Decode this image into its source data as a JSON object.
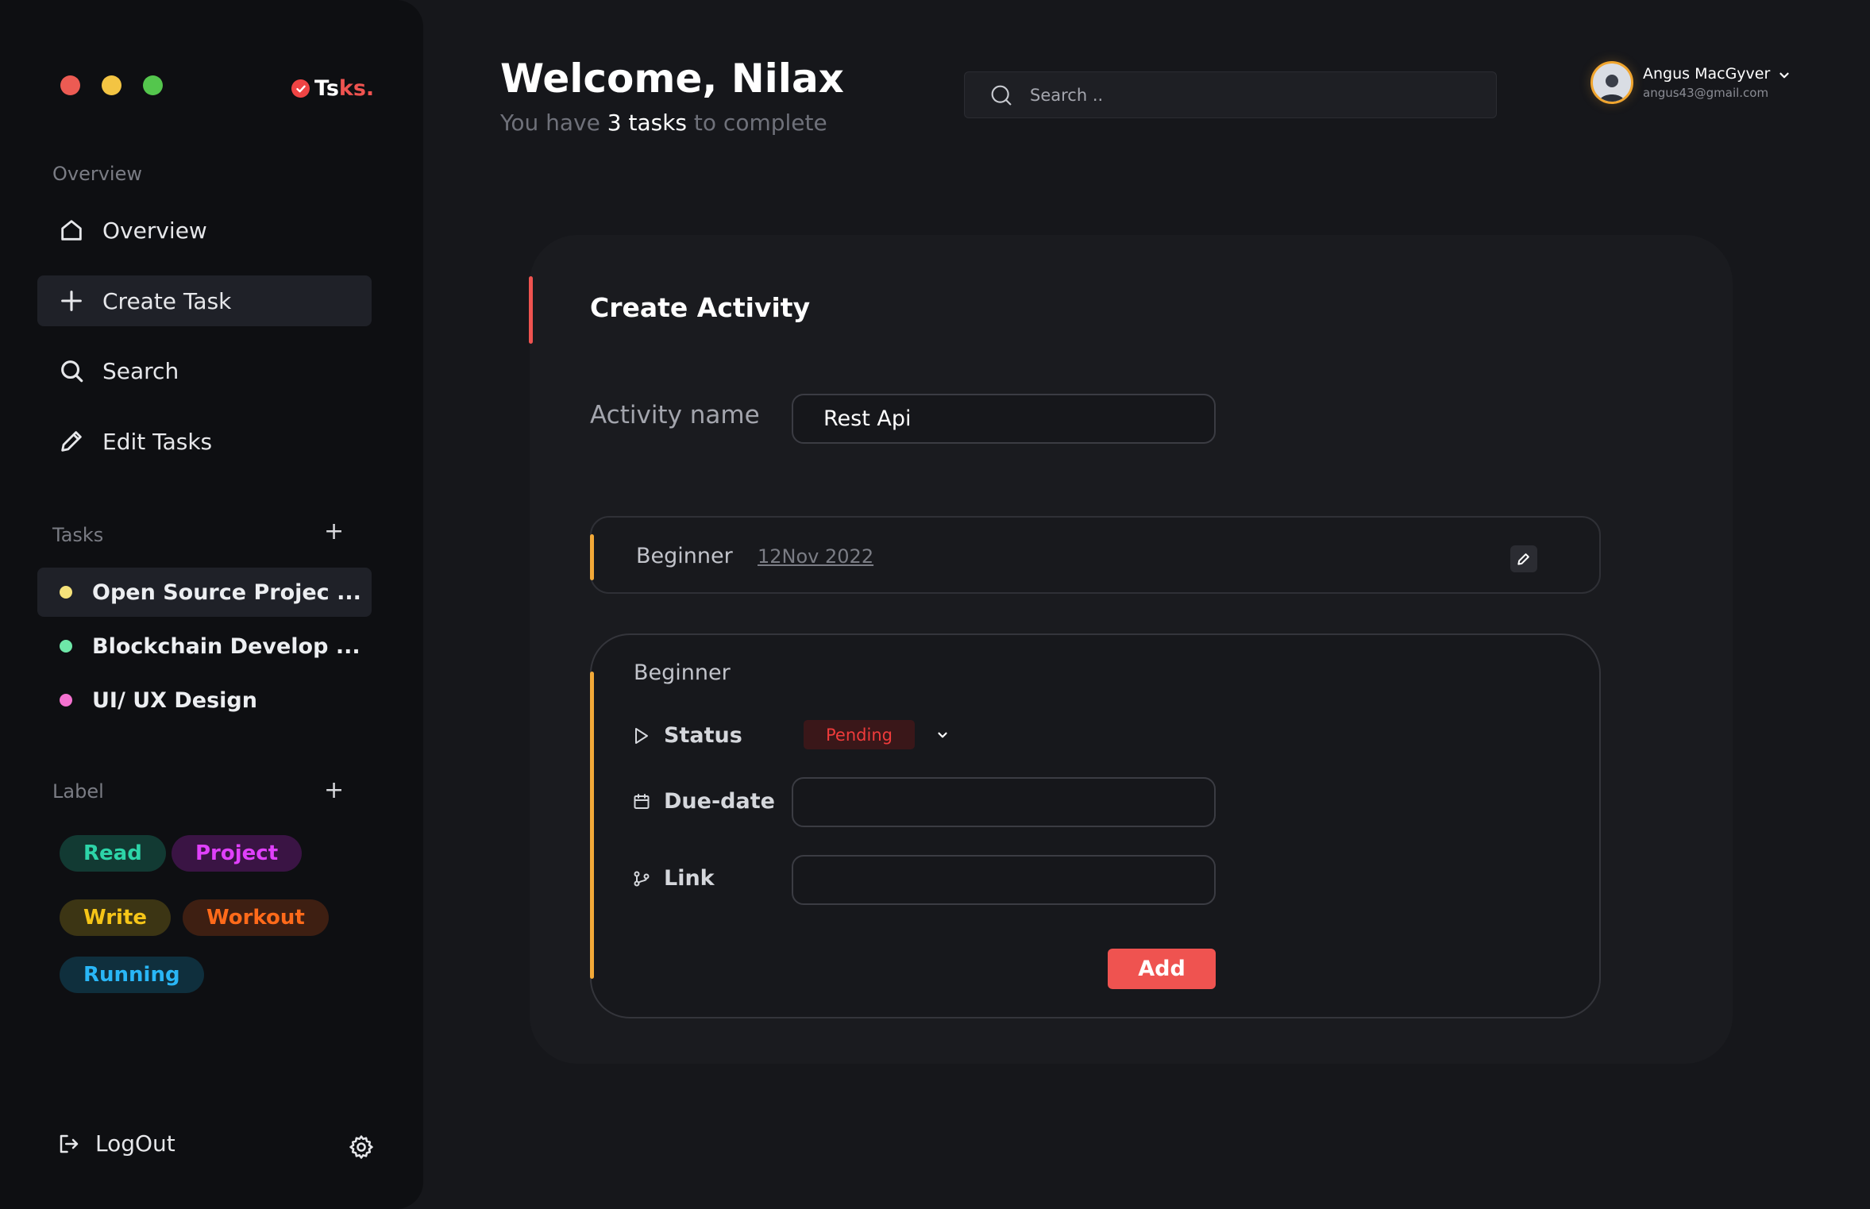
{
  "window": {
    "controls": [
      "close",
      "minimize",
      "maximize"
    ]
  },
  "logo": {
    "prefix": "Ts",
    "suffix": "ks.",
    "icon": "check-circle-icon",
    "accent": "#ef5350"
  },
  "sidebar": {
    "overview_section": "Overview",
    "nav": [
      {
        "label": "Overview",
        "icon": "home-icon"
      },
      {
        "label": "Create Task",
        "icon": "plus-icon",
        "active": true
      },
      {
        "label": "Search",
        "icon": "search-icon"
      },
      {
        "label": "Edit Tasks",
        "icon": "pencil-icon"
      }
    ],
    "tasks_section": "Tasks",
    "tasks": [
      {
        "label": "Open Source Projec ...",
        "color": "#f5e27a",
        "active": true
      },
      {
        "label": "Blockchain Develop ...",
        "color": "#6ee7a8"
      },
      {
        "label": "UI/ UX Design",
        "color": "#f472d0"
      }
    ],
    "label_section": "Label",
    "labels": [
      {
        "text": "Read",
        "fg": "#2dd4a8",
        "bg": "#123a33"
      },
      {
        "text": "Project",
        "fg": "#e040fb",
        "bg": "#3a1444"
      },
      {
        "text": "Write",
        "fg": "#f5c518",
        "bg": "#3c3514"
      },
      {
        "text": "Workout",
        "fg": "#ff6a1a",
        "bg": "#3e1f12"
      },
      {
        "text": "Running",
        "fg": "#29b6f6",
        "bg": "#0f2f3d"
      }
    ],
    "logout": "LogOut"
  },
  "header": {
    "welcome": "Welcome, Nilax",
    "subtitle_pre": "You have ",
    "subtitle_count": "3 tasks",
    "subtitle_post": " to complete",
    "search_placeholder": "Search ..",
    "user_name": "Angus MacGyver",
    "user_email": "angus43@gmail.com"
  },
  "create_activity": {
    "title": "Create Activity",
    "activity_name_label": "Activity name",
    "activity_name_value": "Rest Api",
    "summary_row": {
      "level": "Beginner",
      "date": "12Nov 2022"
    },
    "detail": {
      "level": "Beginner",
      "status_label": "Status",
      "status_value": "Pending",
      "due_label": "Due-date",
      "due_value": "",
      "link_label": "Link",
      "link_value": "",
      "add_button": "Add"
    }
  }
}
